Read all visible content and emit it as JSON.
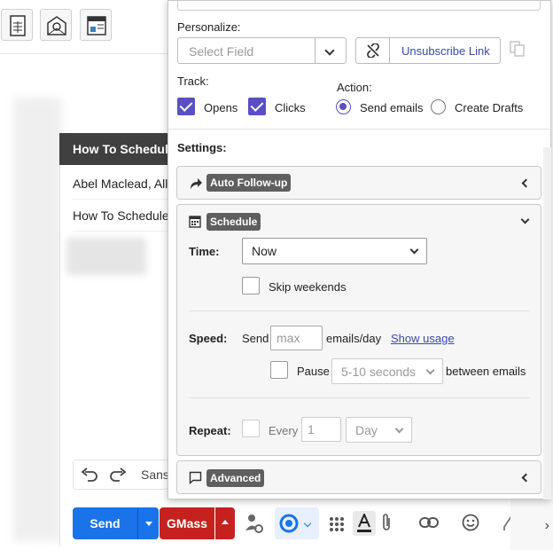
{
  "compose": {
    "header_title": "How To Schedule",
    "to_line": "Abel Maclead, All",
    "subject_line": "How To Schedule",
    "font_name": "Sans",
    "send_label": "Send",
    "gmass_label": "GMass"
  },
  "panel": {
    "personalize_label": "Personalize:",
    "select_field_placeholder": "Select Field",
    "unsubscribe_label": "Unsubscribe Link",
    "track_label": "Track:",
    "opens_label": "Opens",
    "clicks_label": "Clicks",
    "opens_checked": true,
    "clicks_checked": true,
    "action_label": "Action:",
    "send_emails_label": "Send emails",
    "create_drafts_label": "Create Drafts",
    "selected_action": "Send emails",
    "settings_label": "Settings:",
    "auto_followup_label": "Auto Follow-up",
    "schedule_label": "Schedule",
    "time_label": "Time:",
    "time_value": "Now",
    "skip_weekends_label": "Skip weekends",
    "speed_label": "Speed:",
    "send_word": "Send",
    "max_placeholder": "max",
    "emails_day_label": "emails/day",
    "show_usage_label": "Show usage",
    "pause_label": "Pause",
    "pause_value": "5-10 seconds",
    "between_emails_label": "between emails",
    "repeat_label": "Repeat:",
    "every_label": "Every",
    "every_value": "1",
    "repeat_unit": "Day",
    "advanced_label": "Advanced"
  },
  "colors": {
    "accent": "#5b4fc4",
    "send_blue": "#1a73e8",
    "gmass_red": "#c5221f",
    "link": "#3949ab"
  }
}
